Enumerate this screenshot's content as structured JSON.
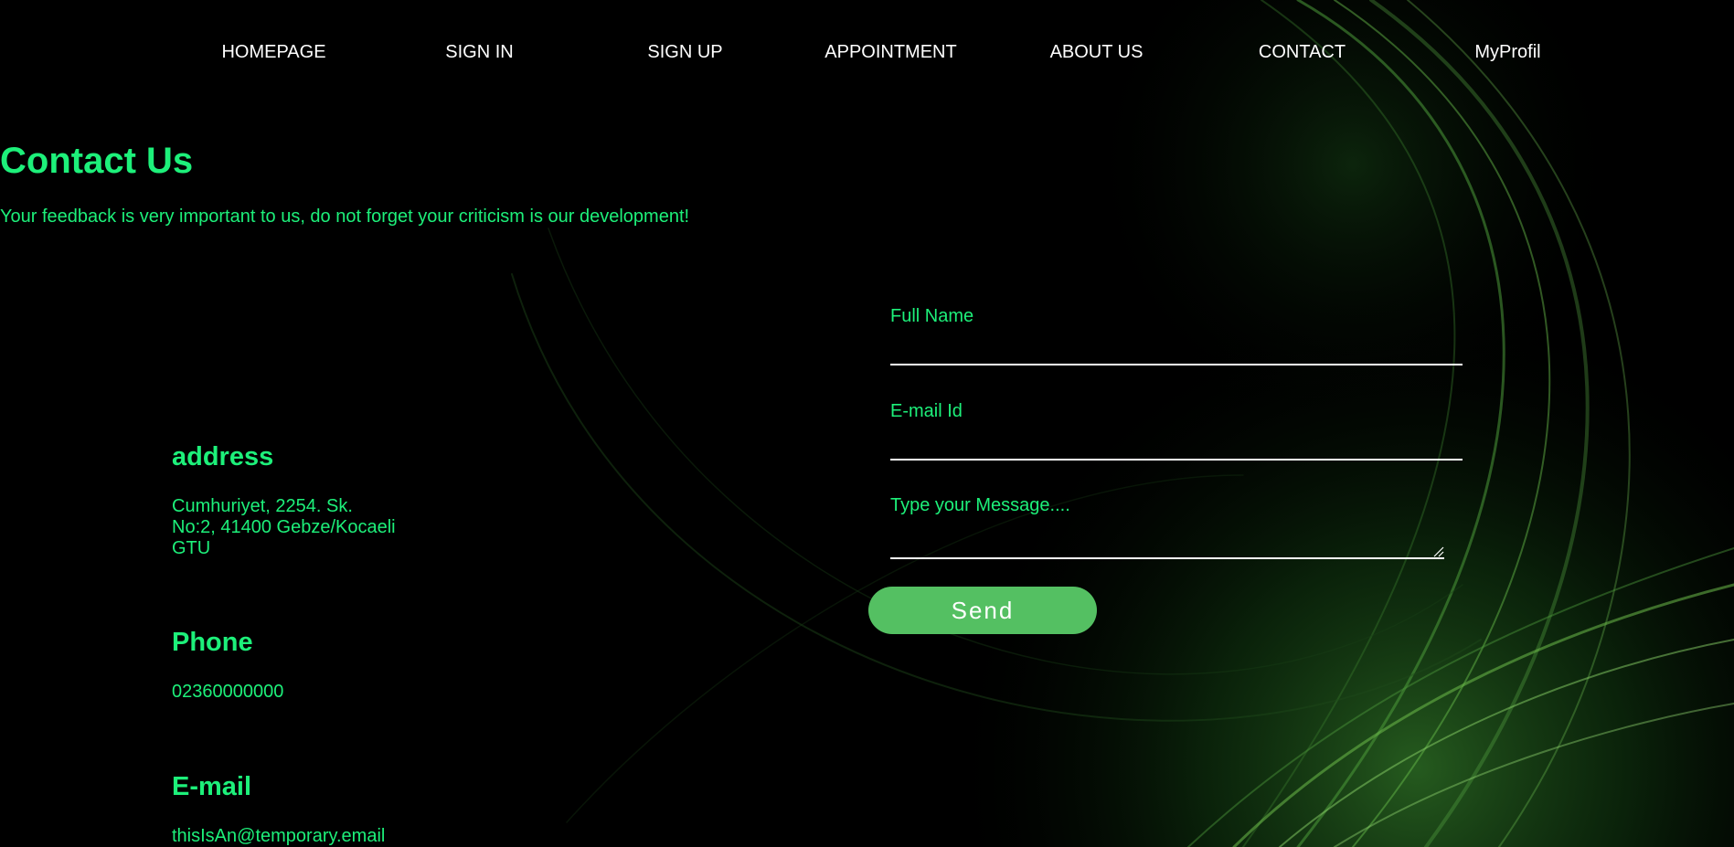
{
  "nav": {
    "items": [
      {
        "label": "HOMEPAGE"
      },
      {
        "label": "SIGN IN"
      },
      {
        "label": "SIGN UP"
      },
      {
        "label": "APPOINTMENT"
      },
      {
        "label": "ABOUT US"
      },
      {
        "label": "CONTACT"
      },
      {
        "label": "MyProfil"
      }
    ]
  },
  "contact": {
    "title": "Contact Us",
    "subtitle": "Your feedback is very important to us, do not forget your criticism is our development!"
  },
  "info": {
    "address": {
      "title": "address",
      "lines": [
        "Cumhuriyet, 2254. Sk.",
        "No:2, 41400 Gebze/Kocaeli",
        "GTU"
      ]
    },
    "phone": {
      "title": "Phone",
      "value": "02360000000"
    },
    "email": {
      "title": "E-mail",
      "value": "thisIsAn@temporary.email"
    }
  },
  "form": {
    "full_name_label": "Full Name",
    "email_label": "E-mail Id",
    "message_label": "Type your Message....",
    "full_name_value": "",
    "email_value": "",
    "message_value": "",
    "send_label": "Send"
  },
  "colors": {
    "background": "#000000",
    "accent_green": "#1df07a",
    "nav_text": "#ffffff",
    "button_green": "#54c062"
  }
}
